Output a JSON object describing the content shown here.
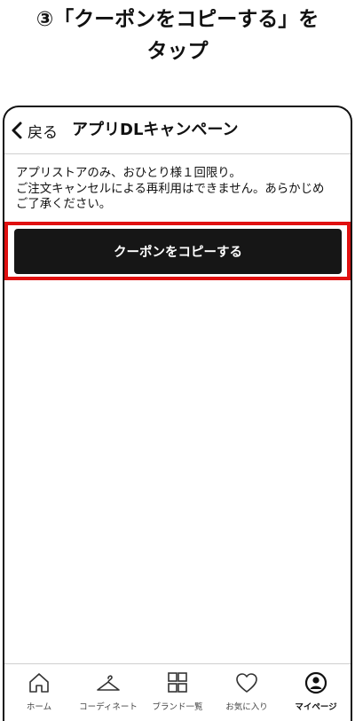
{
  "instruction": {
    "line1": "③「クーポンをコピーする」を",
    "line2": "タップ"
  },
  "header": {
    "back_label": "戻る",
    "title": "アプリDLキャンペーン"
  },
  "note": {
    "line1": "アプリストアのみ、おひとり様１回限り。",
    "line2": "ご注文キャンセルによる再利用はできません。あらかじめ",
    "line3": "ご了承ください。"
  },
  "copy_button": {
    "label": "クーポンをコピーする"
  },
  "colors": {
    "highlight": "#e01010",
    "button": "#161616"
  },
  "tabbar": {
    "items": [
      {
        "label": "ホーム",
        "icon": "home-icon"
      },
      {
        "label": "コーディネート",
        "icon": "hanger-icon"
      },
      {
        "label": "ブランド一覧",
        "icon": "grid-icon"
      },
      {
        "label": "お気に入り",
        "icon": "heart-icon"
      },
      {
        "label": "マイページ",
        "icon": "user-icon",
        "active": true
      }
    ]
  }
}
